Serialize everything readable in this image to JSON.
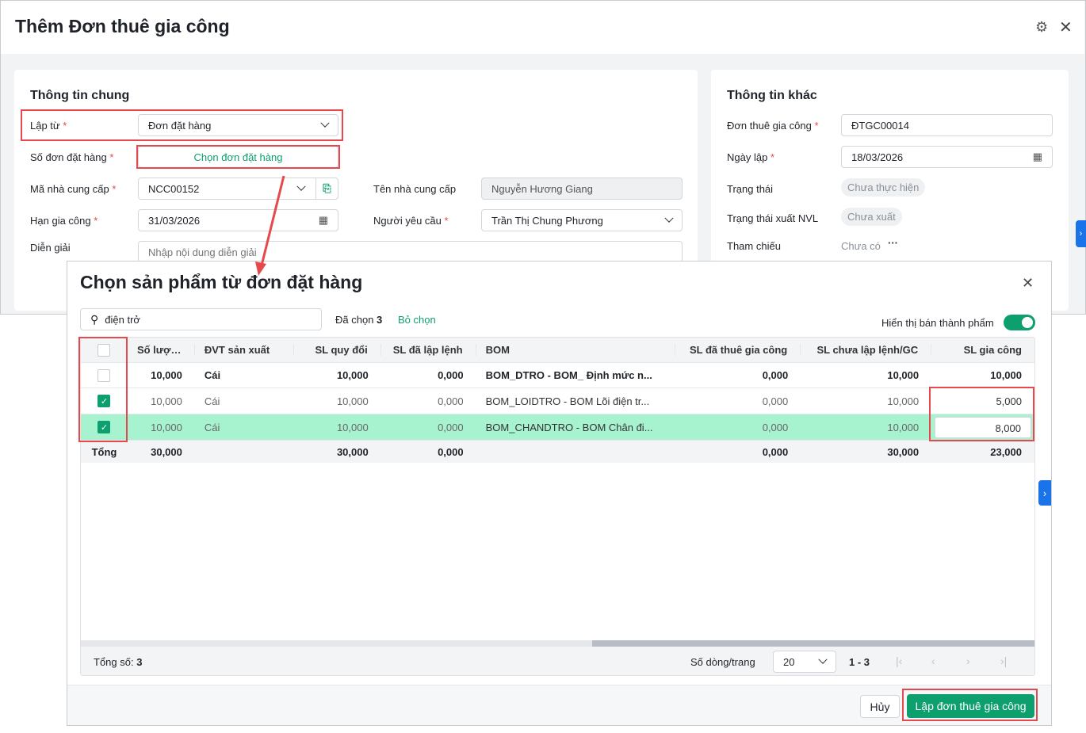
{
  "page": {
    "title": "Thêm Đơn thuê gia công"
  },
  "general": {
    "title": "Thông tin chung",
    "lap_tu_label": "Lập từ",
    "lap_tu_value": "Đơn đặt hàng",
    "so_don_label": "Số đơn đặt hàng",
    "so_don_button": "Chọn đơn đặt hàng",
    "ma_ncc_label": "Mã nhà cung cấp",
    "ma_ncc_value": "NCC00152",
    "ten_ncc_label": "Tên nhà cung cấp",
    "ten_ncc_value": "Nguyễn Hương Giang",
    "han_label": "Hạn gia công",
    "han_value": "31/03/2026",
    "nguoi_label": "Người yêu cầu",
    "nguoi_value": "Trần Thị Chung Phương",
    "dien_giai_label": "Diễn giải",
    "dien_giai_placeholder": "Nhập nội dung diễn giải"
  },
  "other": {
    "title": "Thông tin khác",
    "don_label": "Đơn thuê gia công",
    "don_value": "ĐTGC00014",
    "ngay_label": "Ngày lập",
    "ngay_value": "18/03/2026",
    "trang_thai_label": "Trạng thái",
    "trang_thai_value": "Chưa thực hiện",
    "xuat_label": "Trạng thái xuất NVL",
    "xuat_value": "Chưa xuất",
    "tham_chieu_label": "Tham chiếu",
    "tham_chieu_value": "Chưa có"
  },
  "dialog": {
    "title": "Chọn sản phẩm từ đơn đặt hàng",
    "search_value": "điện trở",
    "selected_label": "Đã chọn",
    "selected_count": "3",
    "deselect": "Bỏ chọn",
    "toggle_label": "Hiển thị bán thành phẩm",
    "columns": [
      "Số lượng",
      "ĐVT sản xuất",
      "SL quy đổi",
      "SL đã lập lệnh",
      "BOM",
      "SL đã thuê gia công",
      "SL chưa lập lệnh/GC",
      "SL gia công"
    ],
    "rows": [
      {
        "checked": false,
        "sl": "10,000",
        "dvt": "Cái",
        "qd": "10,000",
        "dll": "0,000",
        "bom": "BOM_DTRO - BOM_ Định mức n...",
        "dt": "0,000",
        "cl": "10,000",
        "gc": "10,000"
      },
      {
        "checked": true,
        "sl": "10,000",
        "dvt": "Cái",
        "qd": "10,000",
        "dll": "0,000",
        "bom": "BOM_LOIDTRO - BOM Lõi điện tr...",
        "dt": "0,000",
        "cl": "10,000",
        "gc": "5,000"
      },
      {
        "checked": true,
        "sl": "10,000",
        "dvt": "Cái",
        "qd": "10,000",
        "dll": "0,000",
        "bom": "BOM_CHANDTRO - BOM Chân đi...",
        "dt": "0,000",
        "cl": "10,000",
        "gc": "8,000"
      }
    ],
    "total": {
      "label": "Tổng",
      "sl": "30,000",
      "qd": "30,000",
      "dll": "0,000",
      "dt": "0,000",
      "cl": "30,000",
      "gc": "23,000"
    },
    "footer": {
      "total_label": "Tổng số:",
      "total_count": "3",
      "rows_per_page_label": "Số dòng/trang",
      "rows_per_page": "20",
      "range": "1 - 3"
    },
    "cancel": "Hủy",
    "submit": "Lập đơn thuê gia công"
  },
  "colors": {
    "accent": "#0e9f6e",
    "highlight": "#a7f3d0",
    "annotation": "#e5484d",
    "tab": "#1a73e8"
  }
}
